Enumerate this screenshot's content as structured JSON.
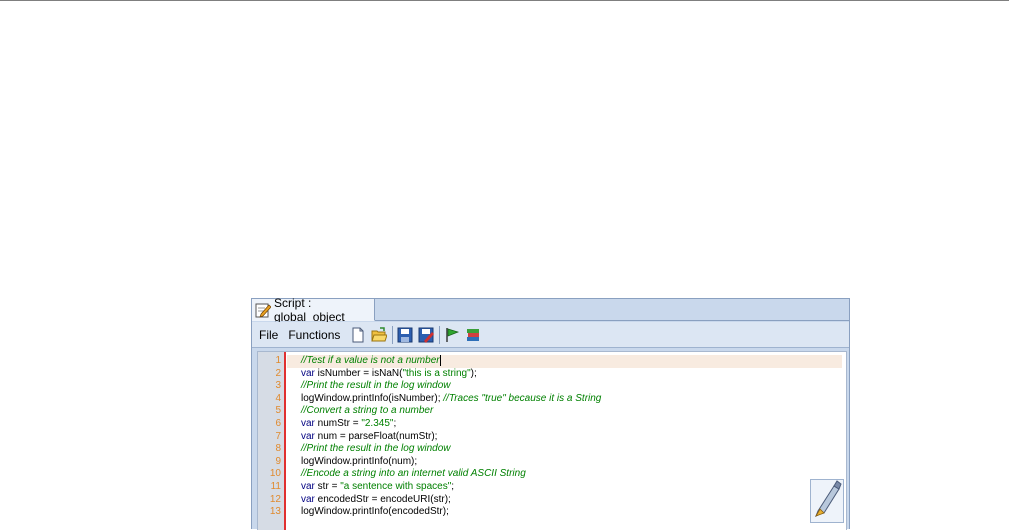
{
  "window": {
    "tab_label": "Script : global_object"
  },
  "toolbar": {
    "file_label": "File",
    "functions_label": "Functions",
    "icons": [
      "new-document-icon",
      "open-folder-icon",
      "save-icon",
      "save-as-icon",
      "run-flag-icon",
      "library-books-icon"
    ]
  },
  "editor": {
    "line_numbers": [
      "1",
      "2",
      "3",
      "4",
      "5",
      "6",
      "7",
      "8",
      "9",
      "10",
      "11",
      "12",
      "13"
    ],
    "lines": [
      [
        {
          "t": "//Test if a value is not a number",
          "c": "cmt"
        }
      ],
      [
        {
          "t": "var",
          "c": "kw"
        },
        {
          "t": " isNumber = isNaN(",
          "c": ""
        },
        {
          "t": "\"this is a string\"",
          "c": "str"
        },
        {
          "t": ");",
          "c": ""
        }
      ],
      [
        {
          "t": "//Print the result in the log window",
          "c": "cmt"
        }
      ],
      [
        {
          "t": "logWindow.printInfo(isNumber); ",
          "c": ""
        },
        {
          "t": "//Traces \"true\" because it is a String",
          "c": "cmt"
        }
      ],
      [
        {
          "t": "//Convert a string to a number",
          "c": "cmt"
        }
      ],
      [
        {
          "t": "var",
          "c": "kw"
        },
        {
          "t": " numStr = ",
          "c": ""
        },
        {
          "t": "\"2.345\"",
          "c": "str"
        },
        {
          "t": ";",
          "c": ""
        }
      ],
      [
        {
          "t": "var",
          "c": "kw"
        },
        {
          "t": " num = parseFloat(numStr);",
          "c": ""
        }
      ],
      [
        {
          "t": "//Print the result in the log window",
          "c": "cmt"
        }
      ],
      [
        {
          "t": "logWindow.printInfo(num);",
          "c": ""
        }
      ],
      [
        {
          "t": "//Encode a string into an internet valid ASCII String",
          "c": "cmt"
        }
      ],
      [
        {
          "t": "var",
          "c": "kw"
        },
        {
          "t": " str = ",
          "c": ""
        },
        {
          "t": "\"a sentence with spaces\"",
          "c": "str"
        },
        {
          "t": ";",
          "c": ""
        }
      ],
      [
        {
          "t": "var",
          "c": "kw"
        },
        {
          "t": " encodedStr = encodeURI(str);",
          "c": ""
        }
      ],
      [
        {
          "t": "logWindow.printInfo(encodedStr);",
          "c": ""
        }
      ]
    ],
    "current_line": 0
  },
  "colors": {
    "line_number": "#e08a2e",
    "margin_marker": "#e03030",
    "comment": "#008000",
    "keyword": "#000080",
    "current_line_bg": "#f8ebe0"
  }
}
